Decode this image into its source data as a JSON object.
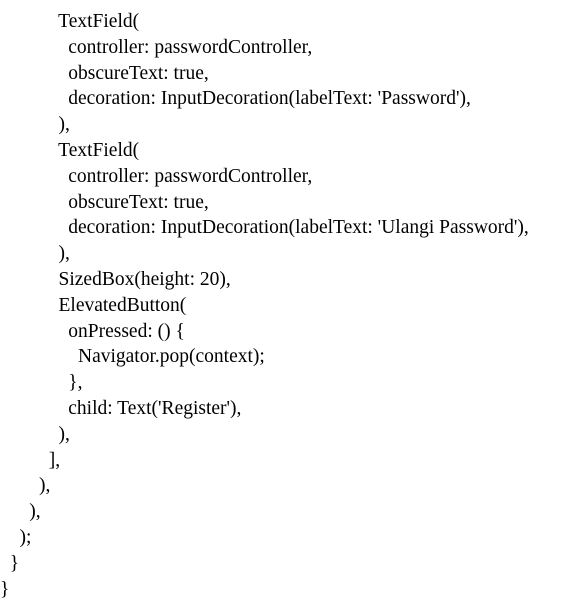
{
  "document": {
    "lines": [
      "            TextField(",
      "              controller: passwordController,",
      "              obscureText: true,",
      "              decoration: InputDecoration(labelText: 'Password'),",
      "            ),",
      "            TextField(",
      "              controller: passwordController,",
      "              obscureText: true,",
      "              decoration: InputDecoration(labelText: 'Ulangi Password'),",
      "            ),",
      "            SizedBox(height: 20),",
      "            ElevatedButton(",
      "              onPressed: () {",
      "                Navigator.pop(context);",
      "              },",
      "              child: Text('Register'),",
      "            ),",
      "          ],",
      "        ),",
      "      ),",
      "    );",
      "  }",
      "}"
    ]
  }
}
